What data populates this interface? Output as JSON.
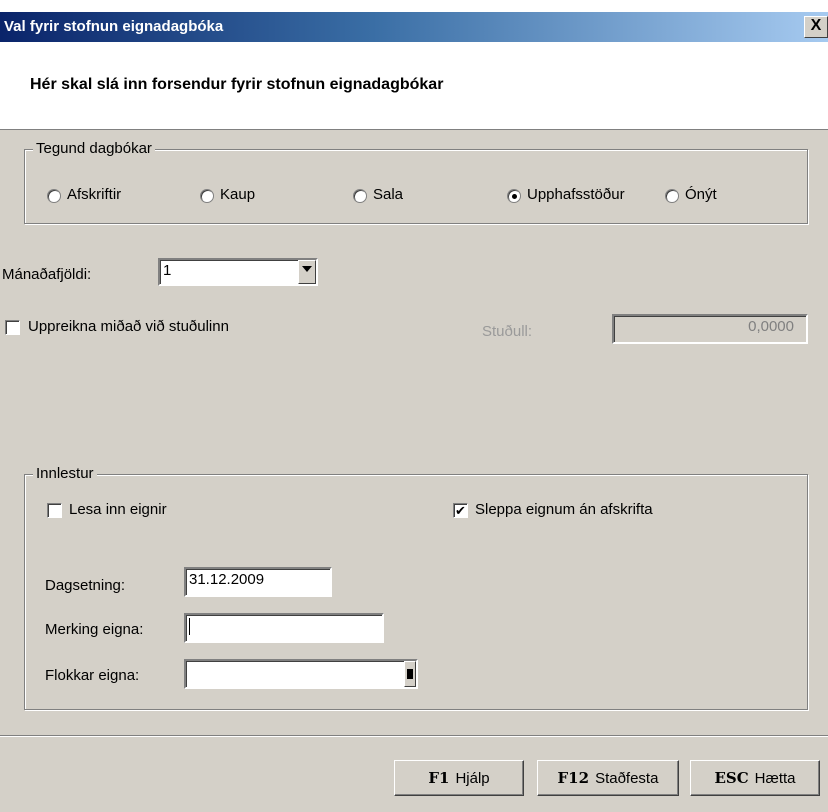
{
  "window": {
    "title": "Val fyrir stofnun eignadagbóka",
    "close_label": "X"
  },
  "header": {
    "text": "Hér skal slá inn forsendur fyrir stofnun eignadagbókar"
  },
  "journal_type": {
    "legend": "Tegund dagbókar",
    "options": [
      {
        "label": "Afskriftir",
        "selected": false
      },
      {
        "label": "Kaup",
        "selected": false
      },
      {
        "label": "Sala",
        "selected": false
      },
      {
        "label": "Upphafsstöður",
        "selected": true
      },
      {
        "label": "Ónýt",
        "selected": false
      }
    ]
  },
  "months": {
    "label": "Mánaðafjöldi:",
    "value": "1"
  },
  "recalc": {
    "label": "Uppreikna miðað við stuðulinn",
    "checked": false
  },
  "factor": {
    "label": "Stuðull:",
    "value": "0,0000"
  },
  "import": {
    "legend": "Innlestur",
    "read_assets": {
      "label": "Lesa inn eignir",
      "checked": false
    },
    "skip_assets": {
      "label": "Sleppa eignum án afskrifta",
      "checked": true,
      "mark": "✔"
    },
    "date": {
      "label": "Dagsetning:",
      "value": "31.12.2009"
    },
    "asset_marking": {
      "label": "Merking eigna:",
      "value": ""
    },
    "asset_classes": {
      "label": "Flokkar eigna:",
      "value": ""
    }
  },
  "buttons": {
    "help": {
      "key": "F1",
      "label": "Hjálp"
    },
    "confirm": {
      "key": "F12",
      "label": "Staðfesta"
    },
    "cancel": {
      "key": "ESC",
      "label": "Hætta"
    }
  }
}
